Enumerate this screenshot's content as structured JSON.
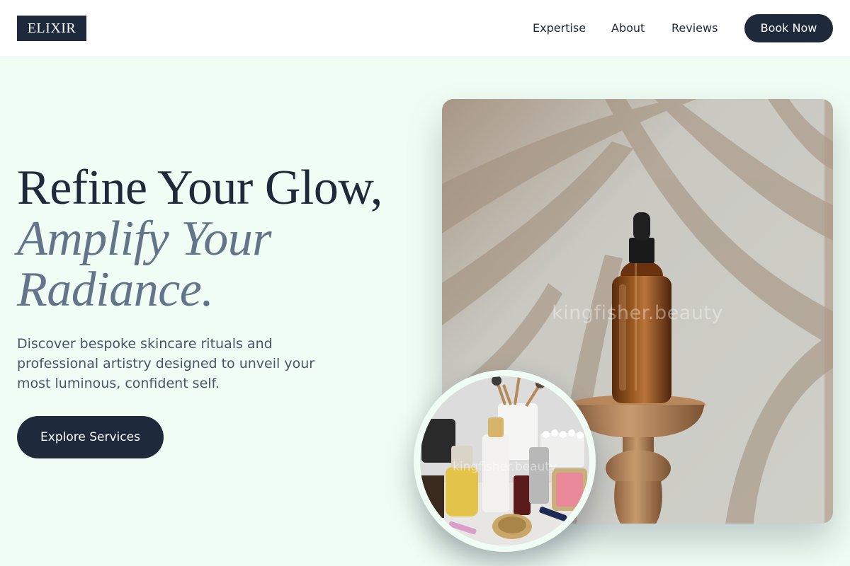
{
  "header": {
    "logo": "ELIXIR",
    "nav": [
      {
        "label": "Expertise"
      },
      {
        "label": "About"
      },
      {
        "label": "Reviews"
      }
    ],
    "cta_label": "Book Now"
  },
  "hero": {
    "headline_line1": "Refine Your Glow,",
    "headline_line2": "Amplify Your",
    "headline_line3": "Radiance.",
    "description": "Discover bespoke skincare rituals and professional artistry designed to unveil your most luminous, confident self.",
    "cta_label": "Explore Services",
    "image_watermark": "kingfisher.beauty",
    "inset_watermark": "kingfisher.beauty"
  },
  "colors": {
    "page_background": "#f0fdf4",
    "primary_dark": "#1e293b",
    "accent_text": "#64748b",
    "body_text": "#475569"
  }
}
